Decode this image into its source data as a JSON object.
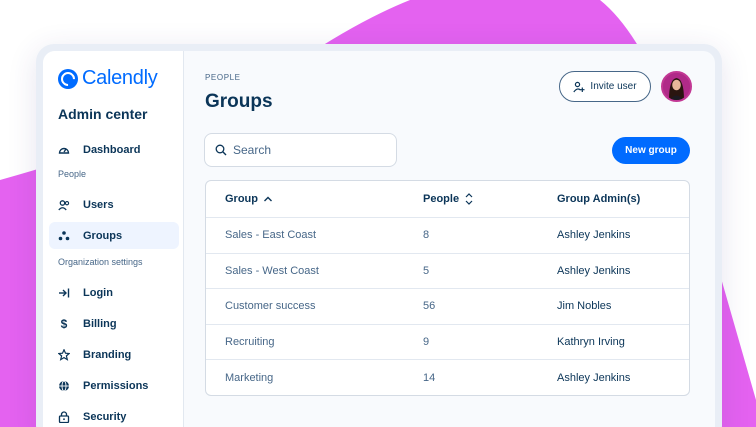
{
  "brand": {
    "name": "Calendly",
    "accent": "#006bff",
    "backdrop": "#e462f0"
  },
  "sidebar": {
    "title": "Admin center",
    "dashboard": "Dashboard",
    "section_people": "People",
    "users": "Users",
    "groups": "Groups",
    "section_org": "Organization settings",
    "login": "Login",
    "billing": "Billing",
    "branding": "Branding",
    "permissions": "Permissions",
    "security": "Security"
  },
  "header": {
    "eyebrow": "PEOPLE",
    "title": "Groups",
    "invite_label": "Invite user"
  },
  "search": {
    "placeholder": "Search"
  },
  "new_group_label": "New group",
  "table": {
    "columns": [
      "Group",
      "People",
      "Group Admin(s)"
    ],
    "rows": [
      {
        "group": "Sales - East Coast",
        "people": "8",
        "admin": "Ashley Jenkins"
      },
      {
        "group": "Sales - West Coast",
        "people": "5",
        "admin": "Ashley Jenkins"
      },
      {
        "group": "Customer success",
        "people": "56",
        "admin": "Jim Nobles"
      },
      {
        "group": "Recruiting",
        "people": "9",
        "admin": "Kathryn Irving"
      },
      {
        "group": "Marketing",
        "people": "14",
        "admin": "Ashley Jenkins"
      }
    ]
  }
}
